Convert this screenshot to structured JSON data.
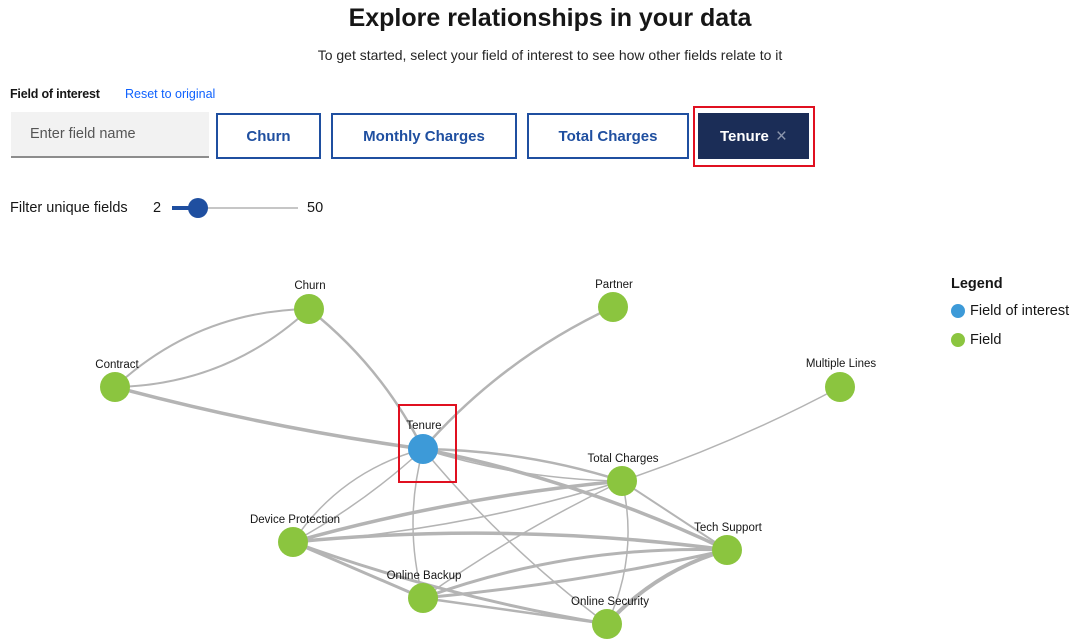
{
  "header": {
    "title": "Explore relationships in your data",
    "subtitle": "To get started, select your field of interest to see how other fields relate to it"
  },
  "field_of_interest": {
    "label": "Field of interest",
    "reset_label": "Reset to original",
    "input_placeholder": "Enter field name",
    "chips": [
      "Churn",
      "Monthly Charges",
      "Total Charges"
    ],
    "selected_chip": "Tenure",
    "remove_icon": "×"
  },
  "filter": {
    "label": "Filter unique fields",
    "min": 2,
    "max": 50,
    "value_fraction": 0.21
  },
  "graph": {
    "nodes": [
      {
        "id": "churn",
        "label": "Churn",
        "type": "field"
      },
      {
        "id": "partner",
        "label": "Partner",
        "type": "field"
      },
      {
        "id": "contract",
        "label": "Contract",
        "type": "field"
      },
      {
        "id": "multiple_lines",
        "label": "Multiple Lines",
        "type": "field"
      },
      {
        "id": "tenure",
        "label": "Tenure",
        "type": "field_of_interest"
      },
      {
        "id": "total_charges",
        "label": "Total Charges",
        "type": "field"
      },
      {
        "id": "device_protection",
        "label": "Device Protection",
        "type": "field"
      },
      {
        "id": "tech_support",
        "label": "Tech Support",
        "type": "field"
      },
      {
        "id": "online_backup",
        "label": "Online Backup",
        "type": "field"
      },
      {
        "id": "online_security",
        "label": "Online Security",
        "type": "field"
      }
    ],
    "colors": {
      "field_of_interest": "#3d9ad8",
      "field": "#8bc53f",
      "edge": "#b4b4b4",
      "highlight": "#e01020"
    }
  },
  "legend": {
    "title": "Legend",
    "items": [
      {
        "label": "Field of interest",
        "type": "field_of_interest"
      },
      {
        "label": "Field",
        "type": "field"
      }
    ]
  }
}
